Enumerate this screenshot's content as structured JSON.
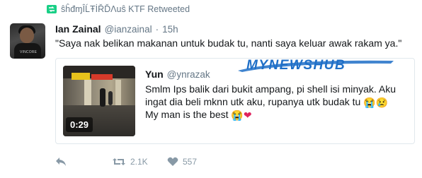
{
  "retweet": {
    "icon": "retweet-icon",
    "text": "ŝĥđɱÎĹŦİŘĎΛuŝ KTF Retweeted"
  },
  "tweet": {
    "avatar_text": "VINCORE",
    "name": "Ian Zainal",
    "handle": "@ianzainal",
    "dot": "·",
    "time": "15h",
    "text": "\"Saya nak belikan makanan untuk budak tu, nanti saya keluar awak rakam ya.\""
  },
  "quote": {
    "video_duration": "0:29",
    "name": "Yun",
    "handle": "@ynrazak",
    "line1": "Smlm Ips balik dari bukit ampang, pi shell isi minyak. Aku",
    "line2": "ingat dia beli mknn utk aku, rupanya utk budak tu",
    "line2_emoji_1": "😭",
    "line2_emoji_2": "😢",
    "line3": "My man is the best",
    "line3_emoji_1": "😭",
    "line3_emoji_2": "❤"
  },
  "watermark": {
    "text": "MYNEWSHUB",
    "color": "#1f6fc7"
  },
  "actions": {
    "reply_icon": "reply-icon",
    "retweet_icon": "retweet-icon",
    "retweet_count": "2.1K",
    "like_icon": "heart-icon",
    "like_count": "557"
  }
}
